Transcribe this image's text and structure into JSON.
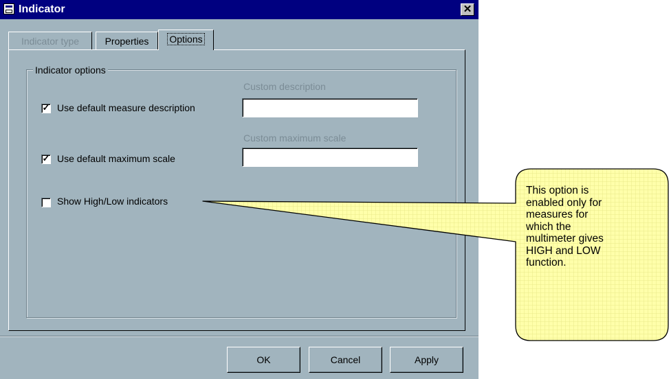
{
  "window": {
    "title": "Indicator",
    "close_glyph": "✕"
  },
  "tabs": [
    {
      "label": "Indicator type",
      "state": "disabled"
    },
    {
      "label": "Properties",
      "state": "normal"
    },
    {
      "label": "Options",
      "state": "active"
    }
  ],
  "group": {
    "label": "Indicator options"
  },
  "options": {
    "description": {
      "checkbox_label": "Use default measure description",
      "checked": true,
      "field_label": "Custom description",
      "field_value": ""
    },
    "max_scale": {
      "checkbox_label": "Use default maximum scale",
      "checked": true,
      "field_label": "Custom maximum scale",
      "field_value": ""
    },
    "high_low": {
      "checkbox_label": "Show High/Low indicators",
      "checked": false
    }
  },
  "buttons": {
    "ok": "OK",
    "cancel": "Cancel",
    "apply": "Apply"
  },
  "check_glyph": "✓",
  "callout": {
    "lines": [
      "This option is",
      "enabled only for",
      "measures for",
      "which the",
      "multimeter gives",
      "HIGH and LOW",
      "function."
    ],
    "fill": "#ffffaa"
  },
  "colors": {
    "titlebar": "#000080",
    "dialog_bg": "#a1b4be",
    "disabled_text": "#7b8c96"
  }
}
